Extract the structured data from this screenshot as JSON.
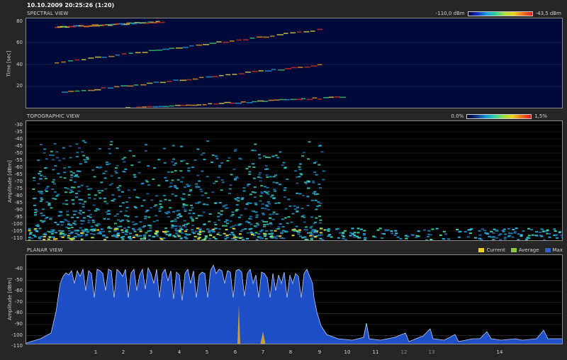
{
  "timestamp": "10.10.2009 20:25:26 (1:20)",
  "spectral": {
    "title": "SPECTRAL VIEW",
    "scale_min": "-110,0 dBm",
    "scale_max": "-43,5 dBm",
    "ylabel": "Time [sec]",
    "yticks": [
      "80",
      "60",
      "40",
      "20"
    ]
  },
  "topographic": {
    "title": "TOPOGRAPHIC VIEW",
    "scale_min": "0.0%",
    "scale_max": "1,5%",
    "ylabel": "Amplitude [dBm]",
    "yticks": [
      "-30",
      "-35",
      "-40",
      "-45",
      "-50",
      "-55",
      "-60",
      "-65",
      "-70",
      "-75",
      "-80",
      "-85",
      "-90",
      "-95",
      "-100",
      "-105",
      "-110"
    ]
  },
  "planar": {
    "title": "PLANAR VIEW",
    "ylabel": "Amplitude [dBm]",
    "yticks": [
      "-40",
      "-50",
      "-60",
      "-70",
      "-80",
      "-90",
      "-100",
      "-110"
    ],
    "legend": [
      {
        "label": "Current",
        "color": "#f0d020"
      },
      {
        "label": "Average",
        "color": "#8cc63f"
      },
      {
        "label": "Max",
        "color": "#2a64c8"
      }
    ]
  },
  "channels": [
    "1",
    "2",
    "3",
    "4",
    "5",
    "6",
    "7",
    "8",
    "9",
    "10",
    "11",
    "12",
    "13",
    "14"
  ],
  "colors": {
    "spectral_bg": "#020a3a",
    "planar_fill": "#1f4fc6",
    "panel_bg": "#262626"
  }
}
